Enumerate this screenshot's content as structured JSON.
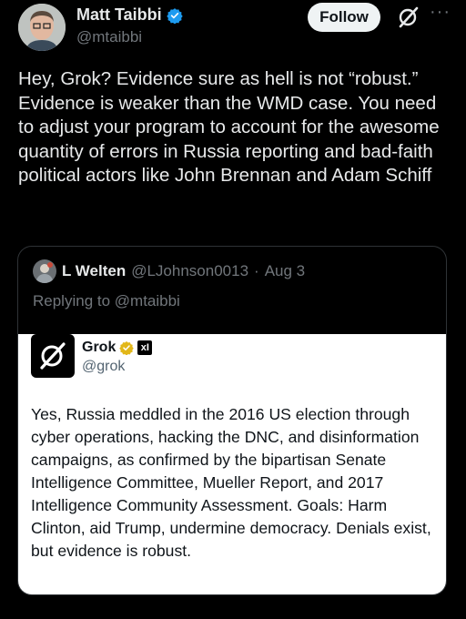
{
  "post": {
    "author_name": "Matt Taibbi",
    "author_handle": "@mtaibbi",
    "follow_label": "Follow",
    "more_label": "···",
    "text": "Hey, Grok? Evidence sure as hell is not “robust.” Evidence is weaker than the WMD case. You need to adjust your program to account for the awesome quantity of errors in Russia reporting and bad-faith political actors like John Brennan and Adam Schiff"
  },
  "quote": {
    "author_name": "L Welten",
    "author_handle": "@LJohnson0013",
    "separator": "·",
    "date": "Aug 3",
    "replying_to": "Replying to @mtaibbi",
    "embedded": {
      "author_name": "Grok",
      "author_handle": "@grok",
      "org_badge": "xI",
      "text": "Yes, Russia meddled in the 2016 US election through cyber operations, hacking the DNC, and disinformation campaigns, as confirmed by the bipartisan Senate Intelligence Committee, Mueller Report, and 2017 Intelligence Community Assessment. Goals: Harm Clinton, aid Trump, undermine democracy. Denials exist, but evidence is robust."
    }
  },
  "colors": {
    "background": "#000000",
    "text_primary": "#e7e9ea",
    "text_secondary": "#71767b",
    "verified_blue": "#1d9bf0",
    "verified_gold": "#e2b719"
  }
}
